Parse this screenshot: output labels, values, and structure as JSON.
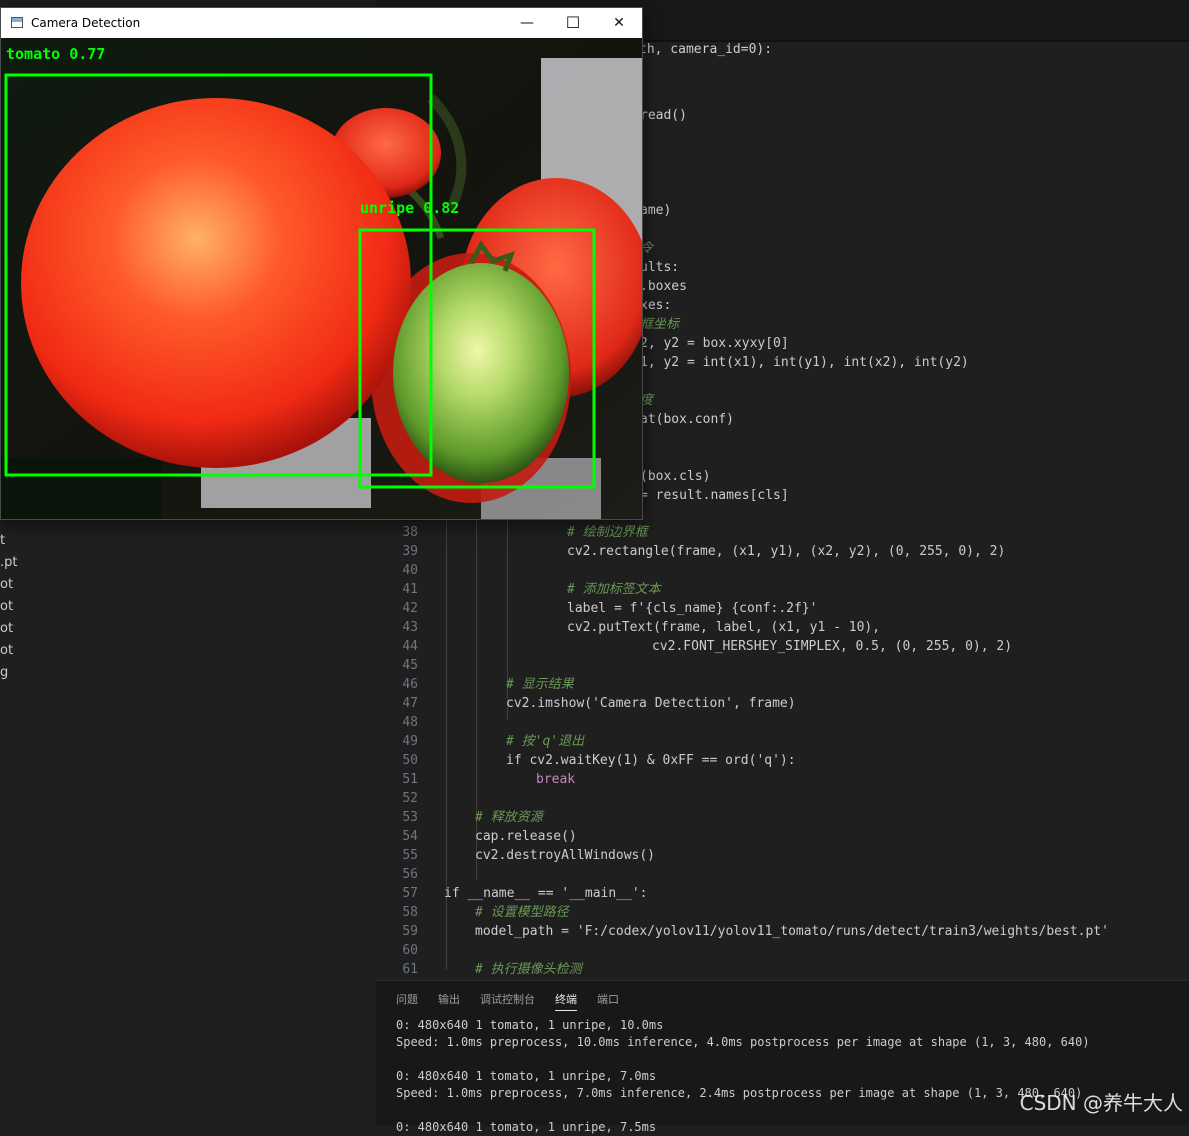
{
  "sidebar": {
    "files": [
      "t",
      ".pt",
      "ot",
      "ot",
      "ot",
      "ot",
      "g"
    ]
  },
  "editor": {
    "header_fragment": "th, camera_id=0):",
    "fragments": [
      "read()",
      "ame)",
      "令",
      "ults:",
      ".boxes",
      "xes:",
      "框坐标",
      "2, y2 = box.xyxy[0]",
      "1, y2 = int(x1), int(y1), int(x2), int(y2)",
      "度",
      "at(box.conf)",
      "(box.cls)",
      "= result.names[cls]"
    ],
    "lines": [
      {
        "n": "38",
        "t": "# 绘制边界框"
      },
      {
        "n": "39",
        "t": "cv2.rectangle(frame, (x1, y1), (x2, y2), (0, 255, 0), 2)"
      },
      {
        "n": "40",
        "t": ""
      },
      {
        "n": "41",
        "t": "# 添加标签文本"
      },
      {
        "n": "42",
        "t": "label = f'{cls_name} {conf:.2f}'"
      },
      {
        "n": "43",
        "t": "cv2.putText(frame, label, (x1, y1 - 10),"
      },
      {
        "n": "44",
        "t": "cv2.FONT_HERSHEY_SIMPLEX, 0.5, (0, 255, 0), 2)"
      },
      {
        "n": "45",
        "t": ""
      },
      {
        "n": "46",
        "t": "# 显示结果"
      },
      {
        "n": "47",
        "t": "cv2.imshow('Camera Detection', frame)"
      },
      {
        "n": "48",
        "t": ""
      },
      {
        "n": "49",
        "t": "# 按'q'退出"
      },
      {
        "n": "50",
        "t": "if cv2.waitKey(1) & 0xFF == ord('q'):"
      },
      {
        "n": "51",
        "t": "break"
      },
      {
        "n": "52",
        "t": ""
      },
      {
        "n": "53",
        "t": "# 释放资源"
      },
      {
        "n": "54",
        "t": "cap.release()"
      },
      {
        "n": "55",
        "t": "cv2.destroyAllWindows()"
      },
      {
        "n": "56",
        "t": ""
      },
      {
        "n": "57",
        "t": "if __name__ == '__main__':"
      },
      {
        "n": "58",
        "t": "# 设置模型路径"
      },
      {
        "n": "59",
        "t": "model_path = 'F:/codex/yolov11/yolov11_tomato/runs/detect/train3/weights/best.pt'"
      },
      {
        "n": "60",
        "t": ""
      },
      {
        "n": "61",
        "t": "# 执行摄像头检测"
      }
    ]
  },
  "panel": {
    "tabs": [
      "问题",
      "输出",
      "调试控制台",
      "终端",
      "端口"
    ],
    "active_tab": "终端",
    "terminal": [
      "0: 480x640 1 tomato, 1 unripe, 10.0ms",
      "Speed: 1.0ms preprocess, 10.0ms inference, 4.0ms postprocess per image at shape (1, 3, 480, 640)",
      "",
      "0: 480x640 1 tomato, 1 unripe, 7.0ms",
      "Speed: 1.0ms preprocess, 7.0ms inference, 2.4ms postprocess per image at shape (1, 3, 480, 640)",
      "",
      "0: 480x640 1 tomato, 1 unripe, 7.5ms"
    ]
  },
  "window": {
    "title": "Camera Detection",
    "controls": {
      "minimize": "—",
      "maximize": "☐",
      "close": "✕"
    },
    "detections": [
      {
        "label": "tomato 0.77",
        "cls": "tomato",
        "conf": 0.77
      },
      {
        "label": "unripe 0.82",
        "cls": "unripe",
        "conf": 0.82
      }
    ],
    "box_color": "#00ff00"
  },
  "watermark": "CSDN @养牛大人"
}
